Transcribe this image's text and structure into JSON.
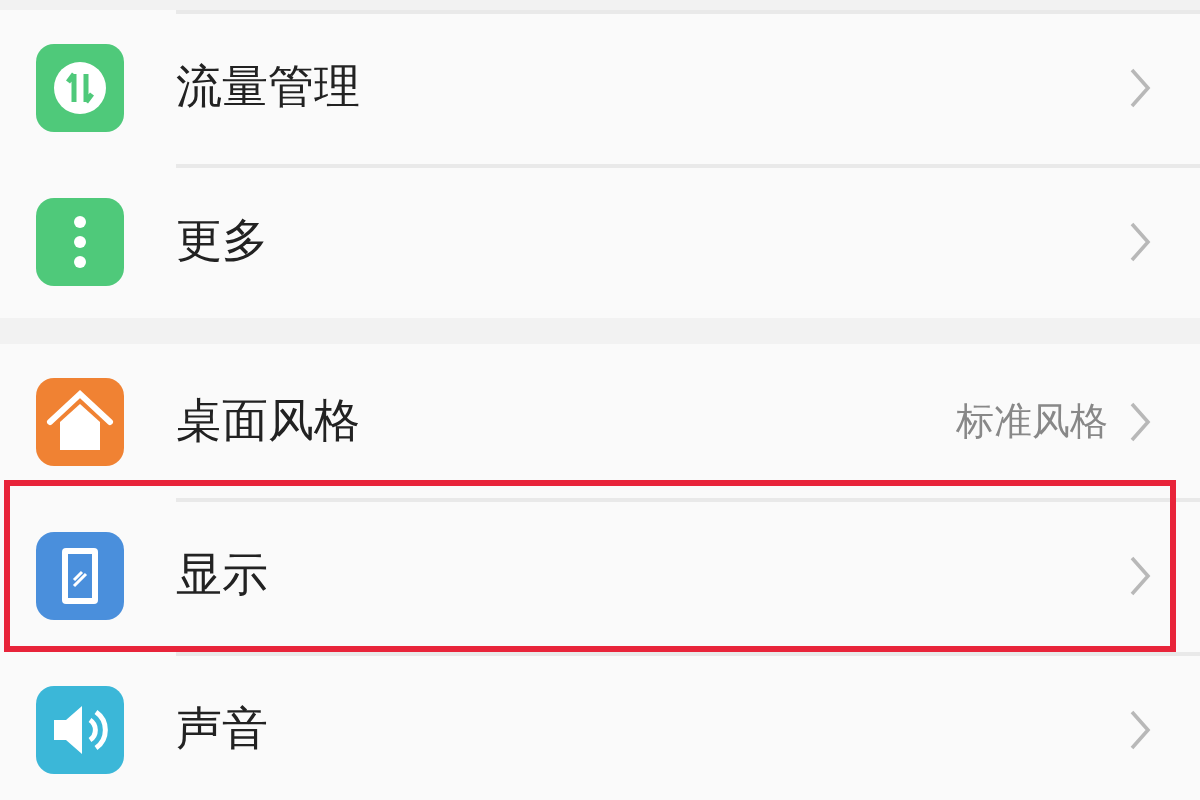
{
  "sections": [
    {
      "items": [
        {
          "label": "流量管理",
          "color": "#4fc97a",
          "highlighted": false
        },
        {
          "label": "更多",
          "color": "#4fc97a",
          "highlighted": false
        }
      ]
    },
    {
      "items": [
        {
          "label": "桌面风格",
          "value": "标准风格",
          "color": "#f08233",
          "highlighted": false
        },
        {
          "label": "显示",
          "color": "#4a8fdc",
          "highlighted": true
        },
        {
          "label": "声音",
          "color": "#3bb7d8",
          "highlighted": false
        }
      ]
    }
  ]
}
